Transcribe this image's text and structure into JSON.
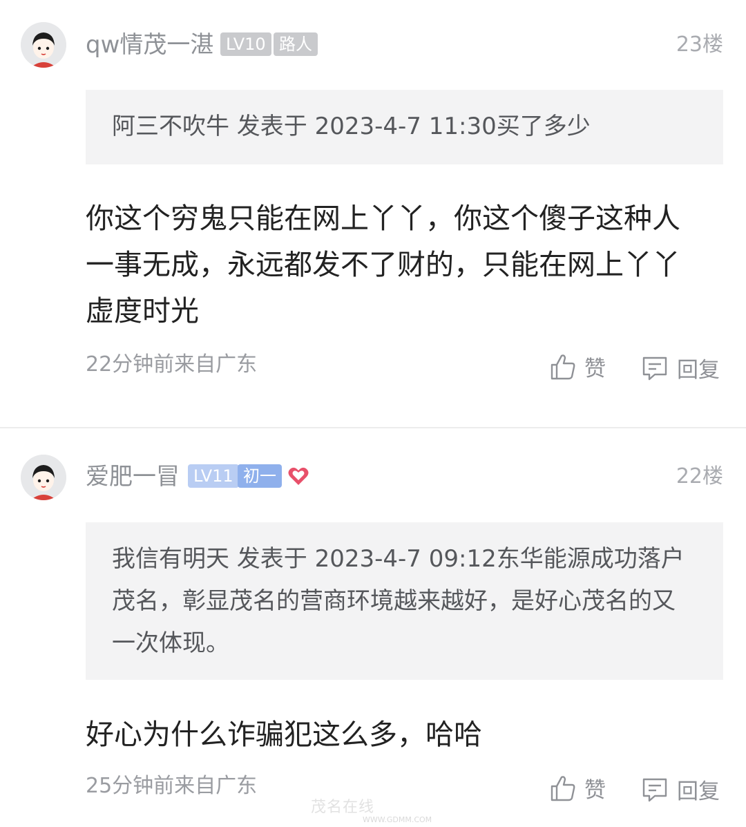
{
  "comments": [
    {
      "username": "qw情茂一湛",
      "level": "LV10",
      "title": "路人",
      "floor": "23楼",
      "quote": "阿三不吹牛 发表于 2023-4-7 11:30买了多少",
      "content": "你这个穷鬼只能在网上丫丫，你这个傻子这种人一事无成，永远都发不了财的，只能在网上丫丫虚度时光",
      "meta": "22分钟前来自广东",
      "like_label": "赞",
      "reply_label": "回复"
    },
    {
      "username": "爱肥一冒",
      "level": "LV11",
      "title": "初一",
      "floor": "22楼",
      "quote": "我信有明天 发表于 2023-4-7 09:12东华能源成功落户茂名，彰显茂名的营商环境越来越好，是好心茂名的又一次体现。",
      "content": "好心为什么诈骗犯这么多，哈哈",
      "meta": "25分钟前来自广东",
      "like_label": "赞",
      "reply_label": "回复"
    }
  ],
  "watermark": {
    "text": "茂名在线",
    "sub": "WWW.GDMM.COM"
  },
  "colors": {
    "badge_gray": "#c9cacd",
    "badge_level_blue": "#b9cdf3",
    "badge_title_blue": "#8fb0ec",
    "heart": "#e8506a"
  },
  "icons": [
    "avatar",
    "heart-icon",
    "thumbs-up-icon",
    "comment-icon"
  ]
}
